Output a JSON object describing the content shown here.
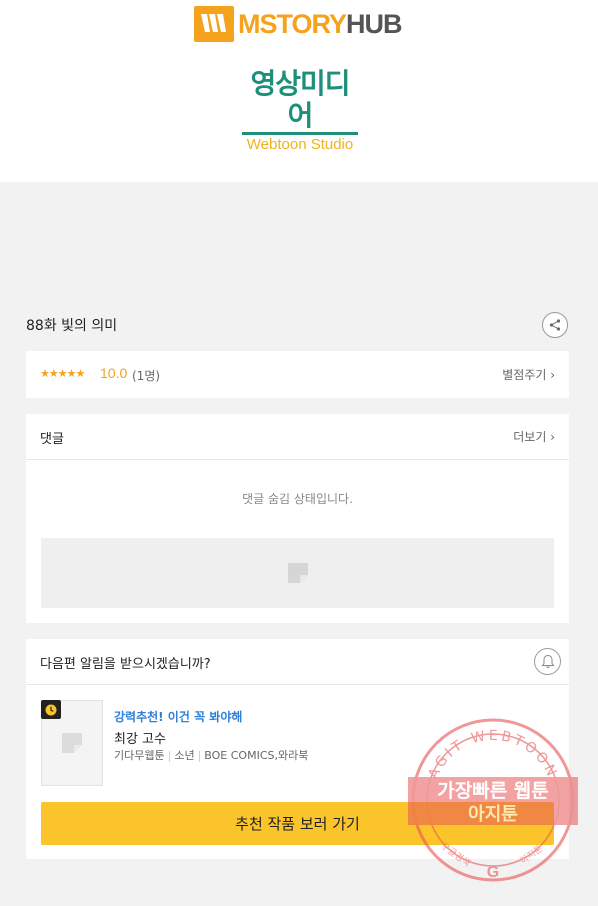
{
  "header": {
    "logo_m": "M",
    "logo_story": "STORY",
    "logo_hub": "HUB",
    "studio_kr": "영상미디어",
    "studio_en": "Webtoon Studio"
  },
  "episode": {
    "title": "88화 빛의 의미"
  },
  "rating": {
    "stars": "★★★★★",
    "score": "10.0",
    "count": "(1명)",
    "rate_link": "별점주기 ›"
  },
  "comments": {
    "title": "댓글",
    "more": "더보기 ›",
    "hidden_message": "댓글 숨김 상태입니다."
  },
  "notify": {
    "question": "다음편 알림을 받으시겠습니까?"
  },
  "recommend": {
    "label": "강력추천! 이건 꼭 봐야해",
    "title": "최강 고수",
    "meta": [
      "기다무웹툰",
      "소년",
      "BOE COMICS,와라북"
    ],
    "button": "추천 작품 보러 가기"
  },
  "watermark": {
    "arc_text": "AGIT WEBTOON",
    "line1": "가장빠른 웹툰",
    "line2": "아지툰",
    "small_left": "구글검색",
    "small_right": "아지툰",
    "small_g": "G"
  },
  "colors": {
    "accent_yellow": "#fbc42a",
    "star_orange": "#f5a21c",
    "link_blue": "#2f7fd6",
    "studio_green": "#1d8f7a",
    "stamp_red": "#e8595a"
  }
}
